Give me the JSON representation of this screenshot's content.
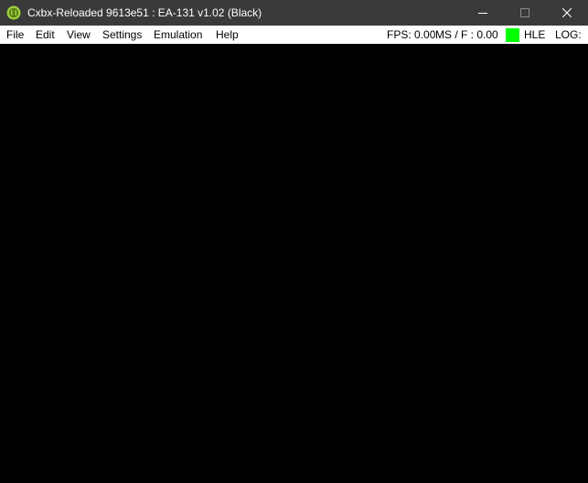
{
  "window": {
    "title": "Cxbx-Reloaded 9613e51 : EA-131 v1.02 (Black)",
    "app_icon": "xbox-green-icon",
    "caption_buttons": [
      "minimize-icon",
      "maximize-icon",
      "close-icon"
    ]
  },
  "menu": {
    "items": [
      {
        "label": "File"
      },
      {
        "label": "Edit"
      },
      {
        "label": "View"
      },
      {
        "label": "Settings"
      },
      {
        "label": "Emulation"
      },
      {
        "label": "Help"
      }
    ]
  },
  "status": {
    "fps": "FPS: 0.00",
    "ms_per_frame": "MS / F : 0.00",
    "mode": "HLE",
    "mode_color": "#00ff00",
    "log": "LOG:"
  },
  "colors": {
    "titlebar": "#3a3a3a",
    "menubar": "#ffffff",
    "render_background": "#000000",
    "icon_accent": "#9bd23c"
  }
}
